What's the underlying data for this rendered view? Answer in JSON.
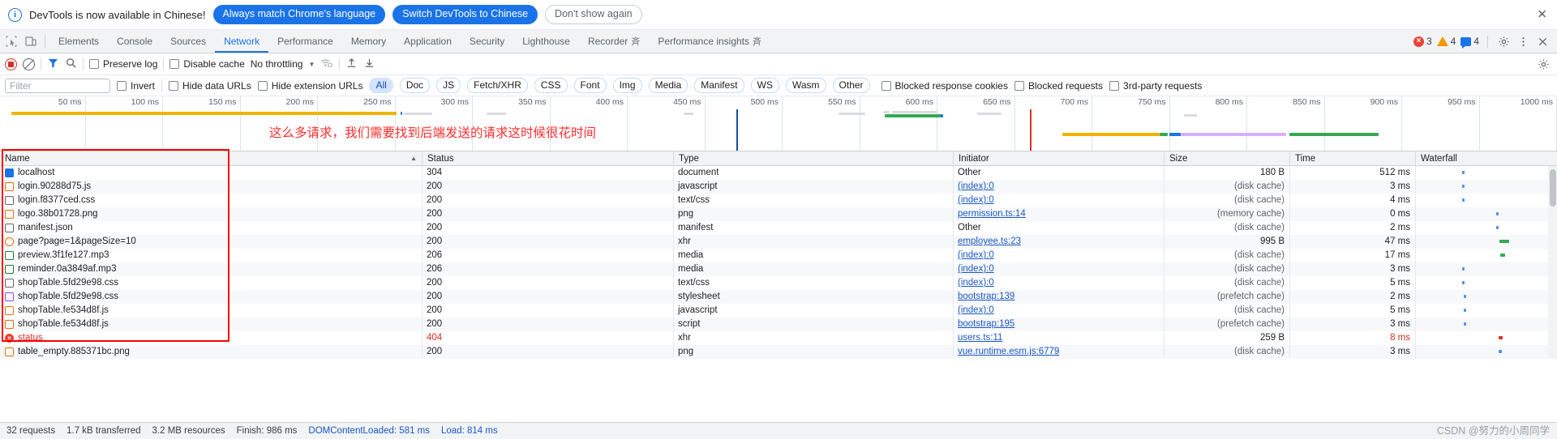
{
  "infobar": {
    "icon": "info-icon",
    "message": "DevTools is now available in Chinese!",
    "always_match_label": "Always match Chrome's language",
    "switch_label": "Switch DevTools to Chinese",
    "dismiss_label": "Don't show again",
    "close_icon": "✕"
  },
  "tabbar": {
    "inspect_icon": "inspect-icon",
    "device_icon": "device-toolbar-icon",
    "tabs": [
      {
        "label": "Elements",
        "active": false,
        "glyph": ""
      },
      {
        "label": "Console",
        "active": false,
        "glyph": ""
      },
      {
        "label": "Sources",
        "active": false,
        "glyph": ""
      },
      {
        "label": "Network",
        "active": true,
        "glyph": ""
      },
      {
        "label": "Performance",
        "active": false,
        "glyph": ""
      },
      {
        "label": "Memory",
        "active": false,
        "glyph": ""
      },
      {
        "label": "Application",
        "active": false,
        "glyph": ""
      },
      {
        "label": "Security",
        "active": false,
        "glyph": ""
      },
      {
        "label": "Lighthouse",
        "active": false,
        "glyph": ""
      },
      {
        "label": "Recorder",
        "active": false,
        "glyph": "斉"
      },
      {
        "label": "Performance insights",
        "active": false,
        "glyph": "斉"
      }
    ],
    "errors_count": "3",
    "warnings_count": "4",
    "messages_count": "4",
    "settings_icon": "gear-icon",
    "more_icon": "kebab-menu-icon",
    "close_icon": "close-icon"
  },
  "nettoolbar": {
    "record_icon": "record-stop-icon",
    "clear_icon": "clear-icon",
    "filter_icon": "funnel-icon",
    "search_icon": "search-icon",
    "preserve_log_label": "Preserve log",
    "preserve_log_checked": false,
    "disable_cache_label": "Disable cache",
    "disable_cache_checked": false,
    "throttling_value": "No throttling",
    "throttling_caret": "▼",
    "wifi_icon": "network-conditions-icon",
    "import_icon": "import-har-icon",
    "export_icon": "export-har-icon",
    "settings_icon": "settings-gear-icon"
  },
  "filterbar": {
    "filter_placeholder": "Filter",
    "filter_value": "",
    "invert_label": "Invert",
    "hide_data_urls_label": "Hide data URLs",
    "hide_extension_urls_label": "Hide extension URLs",
    "types": [
      "All",
      "Doc",
      "JS",
      "Fetch/XHR",
      "CSS",
      "Font",
      "Img",
      "Media",
      "Manifest",
      "WS",
      "Wasm",
      "Other"
    ],
    "selected_type": "All",
    "blocked_response_cookies_label": "Blocked response cookies",
    "blocked_requests_label": "Blocked requests",
    "third_party_requests_label": "3rd-party requests"
  },
  "overview": {
    "ticks": [
      "50 ms",
      "100 ms",
      "150 ms",
      "200 ms",
      "250 ms",
      "300 ms",
      "350 ms",
      "400 ms",
      "450 ms",
      "500 ms",
      "550 ms",
      "600 ms",
      "650 ms",
      "700 ms",
      "750 ms",
      "800 ms",
      "850 ms",
      "900 ms",
      "950 ms",
      "1000 ms"
    ]
  },
  "annotation": {
    "text": "这么多请求，我们需要找到后端发送的请求这时候很花时间",
    "color": "#ff2d2d"
  },
  "table": {
    "columns": [
      "Name",
      "Status",
      "Type",
      "Initiator",
      "Size",
      "Time",
      "Waterfall"
    ],
    "sort_indicator": "▲",
    "rows": [
      {
        "icon": "html-file-icon",
        "name": "localhost",
        "status": "304",
        "type": "document",
        "initiator": "Other",
        "initiator_link": false,
        "size": "180 B",
        "time": "512 ms",
        "error": false
      },
      {
        "icon": "js-file-icon",
        "name": "login.90288d75.js",
        "status": "200",
        "type": "javascript",
        "initiator": "(index):0",
        "initiator_link": true,
        "size": "(disk cache)",
        "time": "3 ms",
        "error": false
      },
      {
        "icon": "css-file-icon",
        "name": "login.f8377ced.css",
        "status": "200",
        "type": "text/css",
        "initiator": "(index):0",
        "initiator_link": true,
        "size": "(disk cache)",
        "time": "4 ms",
        "error": false
      },
      {
        "icon": "image-file-icon",
        "name": "logo.38b01728.png",
        "status": "200",
        "type": "png",
        "initiator": "permission.ts:14",
        "initiator_link": true,
        "size": "(memory cache)",
        "time": "0 ms",
        "error": false
      },
      {
        "icon": "doc-file-icon",
        "name": "manifest.json",
        "status": "200",
        "type": "manifest",
        "initiator": "Other",
        "initiator_link": false,
        "size": "(disk cache)",
        "time": "2 ms",
        "error": false
      },
      {
        "icon": "xhr-file-icon",
        "name": "page?page=1&pageSize=10",
        "status": "200",
        "type": "xhr",
        "initiator": "employee.ts:23",
        "initiator_link": true,
        "size": "995 B",
        "time": "47 ms",
        "error": false
      },
      {
        "icon": "media-file-icon",
        "name": "preview.3f1fe127.mp3",
        "status": "206",
        "type": "media",
        "initiator": "(index):0",
        "initiator_link": true,
        "size": "(disk cache)",
        "time": "17 ms",
        "error": false
      },
      {
        "icon": "media-file-icon",
        "name": "reminder.0a3849af.mp3",
        "status": "206",
        "type": "media",
        "initiator": "(index):0",
        "initiator_link": true,
        "size": "(disk cache)",
        "time": "3 ms",
        "error": false
      },
      {
        "icon": "css-file-icon",
        "name": "shopTable.5fd29e98.css",
        "status": "200",
        "type": "text/css",
        "initiator": "(index):0",
        "initiator_link": true,
        "size": "(disk cache)",
        "time": "5 ms",
        "error": false
      },
      {
        "icon": "stylesheet-file-icon",
        "name": "shopTable.5fd29e98.css",
        "status": "200",
        "type": "stylesheet",
        "initiator": "bootstrap:139",
        "initiator_link": true,
        "size": "(prefetch cache)",
        "time": "2 ms",
        "error": false
      },
      {
        "icon": "js-file-icon",
        "name": "shopTable.fe534d8f.js",
        "status": "200",
        "type": "javascript",
        "initiator": "(index):0",
        "initiator_link": true,
        "size": "(disk cache)",
        "time": "5 ms",
        "error": false
      },
      {
        "icon": "js-file-icon",
        "name": "shopTable.fe534d8f.js",
        "status": "200",
        "type": "script",
        "initiator": "bootstrap:195",
        "initiator_link": true,
        "size": "(prefetch cache)",
        "time": "3 ms",
        "error": false
      },
      {
        "icon": "error-icon",
        "name": "status",
        "status": "404",
        "type": "xhr",
        "initiator": "users.ts:11",
        "initiator_link": true,
        "size": "259 B",
        "time": "8 ms",
        "error": true
      },
      {
        "icon": "image-file-icon",
        "name": "table_empty.885371bc.png",
        "status": "200",
        "type": "png",
        "initiator": "vue.runtime.esm.js:6779",
        "initiator_link": true,
        "size": "(disk cache)",
        "time": "3 ms",
        "error": false
      }
    ]
  },
  "statusbar": {
    "requests": "32 requests",
    "transferred": "1.7 kB transferred",
    "resources": "3.2 MB resources",
    "finish": "Finish: 986 ms",
    "domcontentloaded": "DOMContentLoaded: 581 ms",
    "load": "Load: 814 ms",
    "watermark": "CSDN @努力的小周同学"
  }
}
